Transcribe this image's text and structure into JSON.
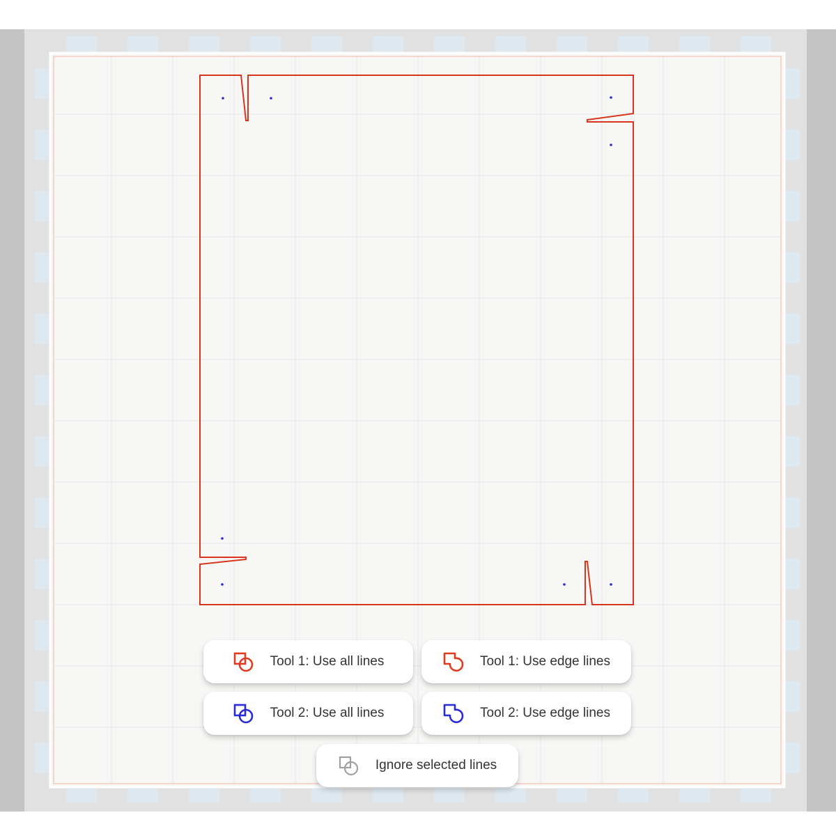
{
  "colors": {
    "tool1": "#e03a1f",
    "tool2": "#2a2ad9",
    "ignore": "#a0a0a0",
    "outline": "#d9351c",
    "point": "#2a2ad9",
    "grid": "#e6e6e6",
    "sheet": "#f7f7f5",
    "marker": "#dde8f0"
  },
  "toolbar": {
    "tool1_all_label": "Tool 1: Use all lines",
    "tool1_edge_label": "Tool 1: Use edge lines",
    "tool2_all_label": "Tool 2: Use all lines",
    "tool2_edge_label": "Tool 2: Use edge lines",
    "ignore_label": "Ignore selected lines"
  },
  "icons": {
    "tool1_all": "overlapping-square-circle-icon",
    "tool1_edge": "merged-square-circle-outline-icon",
    "tool2_all": "overlapping-square-circle-icon",
    "tool2_edge": "merged-square-circle-outline-icon",
    "ignore": "overlapping-square-circle-icon"
  }
}
